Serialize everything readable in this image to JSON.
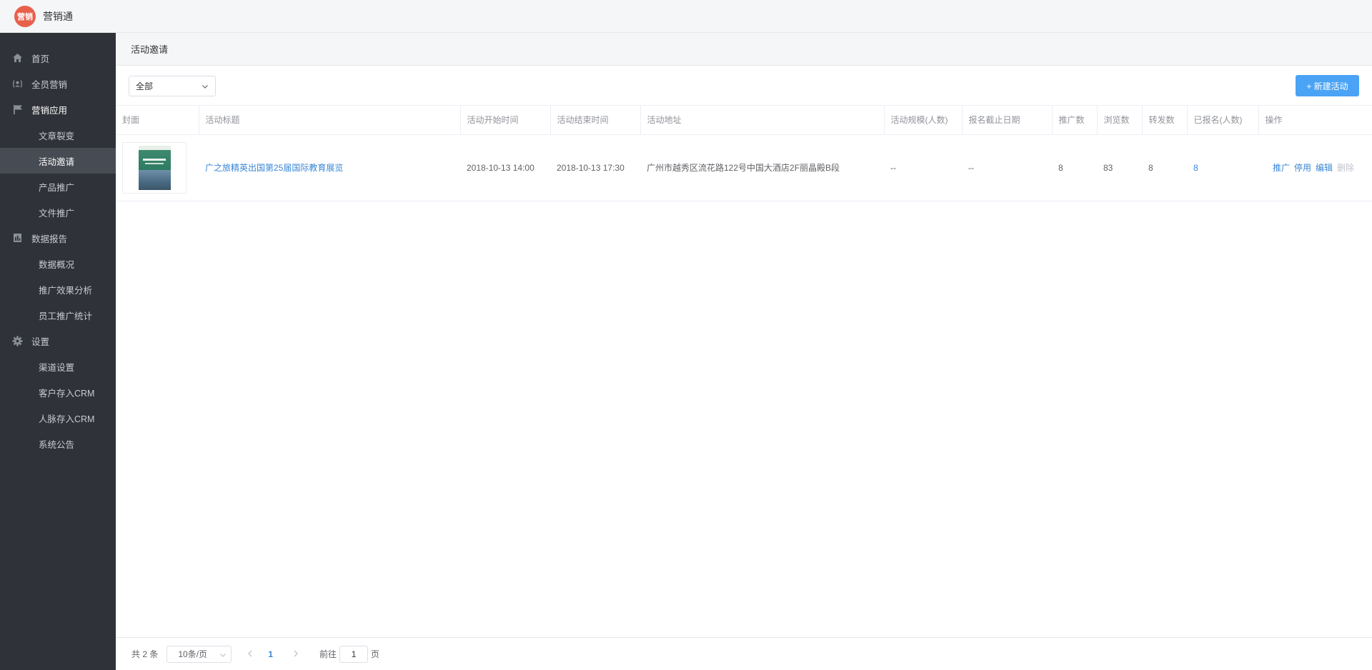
{
  "app": {
    "logo_text": "营销",
    "title": "营销通"
  },
  "sidebar": {
    "groups": [
      {
        "label": "首页",
        "icon": "home-icon",
        "items": []
      },
      {
        "label": "全员营销",
        "icon": "people-icon",
        "items": []
      },
      {
        "label": "营销应用",
        "icon": "flag-icon",
        "items": [
          "文章裂变",
          "活动邀请",
          "产品推广",
          "文件推广"
        ]
      },
      {
        "label": "数据报告",
        "icon": "report-icon",
        "items": [
          "数据概况",
          "推广效果分析",
          "员工推广统计"
        ]
      },
      {
        "label": "设置",
        "icon": "gear-icon",
        "items": [
          "渠道设置",
          "客户存入CRM",
          "人脉存入CRM",
          "系统公告"
        ]
      }
    ],
    "selected_item": "活动邀请"
  },
  "page": {
    "title": "活动邀请"
  },
  "toolbar": {
    "filter_value": "全部",
    "new_button": "+ 新建活动"
  },
  "table": {
    "headers": [
      "封面",
      "活动标题",
      "活动开始时间",
      "活动结束时间",
      "活动地址",
      "活动规模(人数)",
      "报名截止日期",
      "推广数",
      "浏览数",
      "转发数",
      "已报名(人数)",
      "操作"
    ],
    "rows": [
      {
        "title": "广之旅精英出国第25届国际教育展览",
        "start": "2018-10-13 14:00",
        "end": "2018-10-13 17:30",
        "address": "广州市越秀区流花路122号中国大酒店2F丽晶殿B段",
        "scale": "--",
        "deadline": "--",
        "promotions": "8",
        "views": "83",
        "forwards": "8",
        "registered": "8",
        "actions": [
          "推广",
          "停用",
          "编辑",
          "删除"
        ]
      }
    ]
  },
  "pagination": {
    "total": "共 2 条",
    "page_size": "10条/页",
    "current_page": "1",
    "goto_label": "前往",
    "goto_value": "1",
    "goto_suffix": "页"
  },
  "colors": {
    "sidebar_bg": "#2f3238",
    "primary": "#4aa3f5",
    "link": "#3a86d6",
    "logo": "#e8604c"
  }
}
